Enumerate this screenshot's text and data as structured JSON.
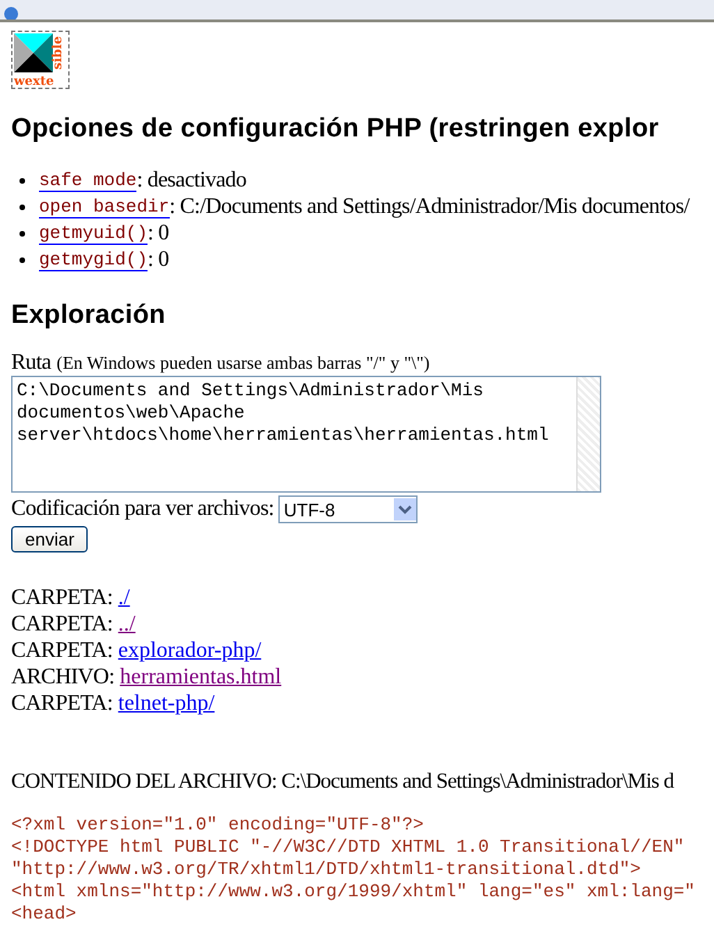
{
  "logo": {
    "left": "wexte",
    "right": "sible"
  },
  "options_heading": "Opciones de configuración PHP (restringen explor",
  "options": [
    {
      "name": "safe mode",
      "value": " : desactivado"
    },
    {
      "name": "open basedir",
      "value": ": C:/Documents and Settings/Administrador/Mis documentos/"
    },
    {
      "name": "getmyuid()",
      "value": ": 0"
    },
    {
      "name": "getmygid()",
      "value": ": 0"
    }
  ],
  "exploration_heading": "Exploración",
  "path_label": "Ruta",
  "path_hint": "(En Windows pueden usarse ambas barras \"/\" y \"\\\")",
  "path_value": "C:\\Documents and Settings\\Administrador\\Mis documentos\\web\\Apache server\\htdocs\\home\\herramientas\\herramientas.html",
  "encoding_label": "Codificación para ver archivos:",
  "encoding_value": "UTF-8",
  "submit": "enviar",
  "entries": [
    {
      "type": "CARPETA:",
      "link": "./",
      "visited": false
    },
    {
      "type": "CARPETA:",
      "link": "../",
      "visited": true
    },
    {
      "type": "CARPETA:",
      "link": "explorador-php/",
      "visited": false
    },
    {
      "type": "ARCHIVO:",
      "link": "herramientas.html",
      "visited": true
    },
    {
      "type": "CARPETA:",
      "link": "telnet-php/",
      "visited": false
    }
  ],
  "content_label": "CONTENIDO DEL ARCHIVO: C:\\Documents and Settings\\Administrador\\Mis d",
  "code_lines": [
    "<?xml version=\"1.0\" encoding=\"UTF-8\"?>",
    "<!DOCTYPE html PUBLIC \"-//W3C//DTD XHTML 1.0 Transitional//EN\"",
    "\"http://www.w3.org/TR/xhtml1/DTD/xhtml1-transitional.dtd\">",
    "<html xmlns=\"http://www.w3.org/1999/xhtml\" lang=\"es\" xml:lang=\"",
    "<head>"
  ]
}
